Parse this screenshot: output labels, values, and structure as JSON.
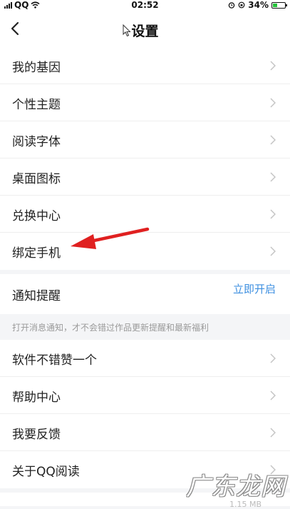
{
  "status_bar": {
    "carrier": "QQ",
    "time": "02:52",
    "battery": "34%"
  },
  "nav": {
    "title": "设置"
  },
  "group1": [
    {
      "label": "我的基因"
    },
    {
      "label": "个性主题"
    },
    {
      "label": "阅读字体"
    },
    {
      "label": "桌面图标"
    },
    {
      "label": "兑换中心"
    },
    {
      "label": "绑定手机"
    }
  ],
  "notification": {
    "label": "通知提醒",
    "action": "立即开启"
  },
  "hint": "打开消息通知，才不会错过作品更新提醒和最新福利",
  "group2": [
    {
      "label": "软件不错赞一个"
    },
    {
      "label": "帮助中心"
    },
    {
      "label": "我要反馈"
    },
    {
      "label": "关于QQ阅读"
    }
  ],
  "bottom_peek": "1.15 MB",
  "watermark": "广东龙网",
  "colors": {
    "accent": "#3d8fe0",
    "arrow": "#e02020",
    "background": "#f4f5f7"
  }
}
